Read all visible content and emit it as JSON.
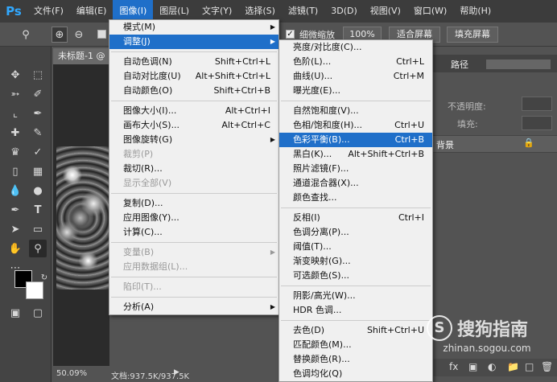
{
  "app": {
    "logo": "Ps"
  },
  "menubar": {
    "items": [
      "文件(F)",
      "编辑(E)",
      "图像(I)",
      "图层(L)",
      "文字(Y)",
      "选择(S)",
      "滤镜(T)",
      "3D(D)",
      "视图(V)",
      "窗口(W)",
      "帮助(H)"
    ],
    "active_index": 2
  },
  "options_bar": {
    "fine_zoom_label": "细微缩放",
    "zoom_value": "100%",
    "fit_screen": "适合屏幕",
    "fill_screen": "填充屏幕"
  },
  "document": {
    "tab_title": "未标题-1 @",
    "zoom": "50.09%",
    "doc_info": "文档:937.5K/937.5K"
  },
  "panels": {
    "path_tab": "路径",
    "opacity_label": "不透明度:",
    "fill_label": "填充:",
    "background_layer": "背景"
  },
  "image_menu": {
    "groups": [
      [
        {
          "label": "模式(M)",
          "shortcut": "",
          "submenu": true,
          "disabled": false
        },
        {
          "label": "调整(J)",
          "shortcut": "",
          "submenu": true,
          "disabled": false,
          "highlighted": true
        }
      ],
      [
        {
          "label": "自动色调(N)",
          "shortcut": "Shift+Ctrl+L",
          "submenu": false,
          "disabled": false
        },
        {
          "label": "自动对比度(U)",
          "shortcut": "Alt+Shift+Ctrl+L",
          "submenu": false,
          "disabled": false
        },
        {
          "label": "自动颜色(O)",
          "shortcut": "Shift+Ctrl+B",
          "submenu": false,
          "disabled": false
        }
      ],
      [
        {
          "label": "图像大小(I)...",
          "shortcut": "Alt+Ctrl+I",
          "submenu": false,
          "disabled": false
        },
        {
          "label": "画布大小(S)...",
          "shortcut": "Alt+Ctrl+C",
          "submenu": false,
          "disabled": false
        },
        {
          "label": "图像旋转(G)",
          "shortcut": "",
          "submenu": true,
          "disabled": false
        },
        {
          "label": "裁剪(P)",
          "shortcut": "",
          "submenu": false,
          "disabled": true
        },
        {
          "label": "裁切(R)...",
          "shortcut": "",
          "submenu": false,
          "disabled": false
        },
        {
          "label": "显示全部(V)",
          "shortcut": "",
          "submenu": false,
          "disabled": true
        }
      ],
      [
        {
          "label": "复制(D)...",
          "shortcut": "",
          "submenu": false,
          "disabled": false
        },
        {
          "label": "应用图像(Y)...",
          "shortcut": "",
          "submenu": false,
          "disabled": false
        },
        {
          "label": "计算(C)...",
          "shortcut": "",
          "submenu": false,
          "disabled": false
        }
      ],
      [
        {
          "label": "变量(B)",
          "shortcut": "",
          "submenu": true,
          "disabled": true
        },
        {
          "label": "应用数据组(L)...",
          "shortcut": "",
          "submenu": false,
          "disabled": true
        }
      ],
      [
        {
          "label": "陷印(T)...",
          "shortcut": "",
          "submenu": false,
          "disabled": true
        }
      ],
      [
        {
          "label": "分析(A)",
          "shortcut": "",
          "submenu": true,
          "disabled": false
        }
      ]
    ]
  },
  "adjust_menu": {
    "groups": [
      [
        {
          "label": "亮度/对比度(C)...",
          "shortcut": ""
        },
        {
          "label": "色阶(L)...",
          "shortcut": "Ctrl+L"
        },
        {
          "label": "曲线(U)...",
          "shortcut": "Ctrl+M"
        },
        {
          "label": "曝光度(E)...",
          "shortcut": ""
        }
      ],
      [
        {
          "label": "自然饱和度(V)...",
          "shortcut": ""
        },
        {
          "label": "色相/饱和度(H)...",
          "shortcut": "Ctrl+U"
        },
        {
          "label": "色彩平衡(B)...",
          "shortcut": "Ctrl+B",
          "highlighted": true
        },
        {
          "label": "黑白(K)...",
          "shortcut": "Alt+Shift+Ctrl+B"
        },
        {
          "label": "照片滤镜(F)...",
          "shortcut": ""
        },
        {
          "label": "通道混合器(X)...",
          "shortcut": ""
        },
        {
          "label": "颜色查找...",
          "shortcut": ""
        }
      ],
      [
        {
          "label": "反相(I)",
          "shortcut": "Ctrl+I"
        },
        {
          "label": "色调分离(P)...",
          "shortcut": ""
        },
        {
          "label": "阈值(T)...",
          "shortcut": ""
        },
        {
          "label": "渐变映射(G)...",
          "shortcut": ""
        },
        {
          "label": "可选颜色(S)...",
          "shortcut": ""
        }
      ],
      [
        {
          "label": "阴影/高光(W)...",
          "shortcut": ""
        },
        {
          "label": "HDR 色调...",
          "shortcut": ""
        }
      ],
      [
        {
          "label": "去色(D)",
          "shortcut": "Shift+Ctrl+U"
        },
        {
          "label": "匹配颜色(M)...",
          "shortcut": ""
        },
        {
          "label": "替换颜色(R)...",
          "shortcut": ""
        },
        {
          "label": "色调均化(Q)",
          "shortcut": ""
        }
      ]
    ]
  },
  "watermark": {
    "text": "搜狗指南",
    "url": "zhinan.sogou.com"
  },
  "colors": {
    "accent": "#1f6fc9",
    "ps_blue": "#31a8ff"
  }
}
